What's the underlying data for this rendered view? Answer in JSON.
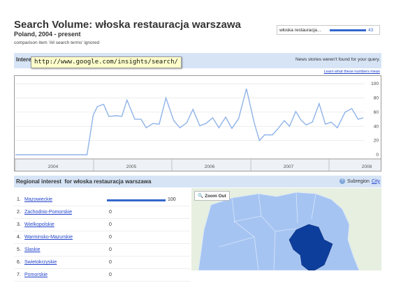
{
  "title": "Search Volume: włoska restauracja warszawa",
  "subtitle": "Poland, 2004 - present",
  "comparison_note": "comparison item 'All search terms' ignored",
  "search_term": {
    "label": "włoska restauracja...",
    "value": "43",
    "fraction": 1.0
  },
  "interest": {
    "label": "Interest",
    "news_note": "News stories weren't found for your query.",
    "learn_link": "Learn what these numbers mean"
  },
  "tooltip_url": "http://www.google.com/insights/search/",
  "chart_data": {
    "type": "line",
    "x_tick_labels": [
      "2004",
      "2005",
      "2006",
      "2007",
      "2008"
    ],
    "y_ticks": [
      0,
      20,
      40,
      60,
      80,
      100
    ],
    "ylim": [
      0,
      110
    ],
    "grid": "horizontal",
    "series": [
      {
        "color": "#8fb3e8",
        "points": [
          [
            2004.0,
            0
          ],
          [
            2004.5,
            0
          ],
          [
            2005.0,
            0
          ],
          [
            2005.2,
            0
          ],
          [
            2005.38,
            0
          ],
          [
            2005.5,
            56
          ],
          [
            2005.58,
            68
          ],
          [
            2005.7,
            71
          ],
          [
            2005.8,
            54
          ],
          [
            2005.95,
            55
          ],
          [
            2006.05,
            54
          ],
          [
            2006.15,
            77
          ],
          [
            2006.3,
            50
          ],
          [
            2006.42,
            50
          ],
          [
            2006.52,
            38
          ],
          [
            2006.65,
            44
          ],
          [
            2006.77,
            43
          ],
          [
            2006.9,
            80
          ],
          [
            2007.05,
            48
          ],
          [
            2007.17,
            38
          ],
          [
            2007.3,
            45
          ],
          [
            2007.42,
            64
          ],
          [
            2007.55,
            41
          ],
          [
            2007.67,
            44
          ],
          [
            2007.8,
            52
          ],
          [
            2007.92,
            38
          ],
          [
            2008.05,
            53
          ],
          [
            2008.17,
            37
          ],
          [
            2008.3,
            51
          ],
          [
            2008.45,
            93
          ],
          [
            2008.6,
            45
          ],
          [
            2008.7,
            20
          ],
          [
            2008.8,
            28
          ],
          [
            2008.95,
            28
          ],
          [
            2009.05,
            36
          ],
          [
            2009.18,
            48
          ],
          [
            2009.28,
            40
          ],
          [
            2009.4,
            61
          ],
          [
            2009.5,
            49
          ],
          [
            2009.6,
            42
          ],
          [
            2009.72,
            46
          ],
          [
            2009.85,
            72
          ],
          [
            2009.97,
            43
          ],
          [
            2010.08,
            46
          ],
          [
            2010.2,
            38
          ],
          [
            2010.35,
            60
          ],
          [
            2010.48,
            65
          ],
          [
            2010.6,
            50
          ],
          [
            2010.7,
            52
          ]
        ]
      }
    ]
  },
  "regional": {
    "label": "Regional interest",
    "label_for": "for włoska restauracja warszawa",
    "subregion_label": "Subregion",
    "subregion_link": "City",
    "items": [
      {
        "num": "1.",
        "name": "Mazowieckie",
        "value": "100",
        "fraction": 1.0
      },
      {
        "num": "2.",
        "name": "Zachodnio-Pomorskie",
        "value": "0",
        "fraction": 0
      },
      {
        "num": "3.",
        "name": "Wielkopolskie",
        "value": "0",
        "fraction": 0
      },
      {
        "num": "4.",
        "name": "Warminsko-Mazurskie",
        "value": "0",
        "fraction": 0
      },
      {
        "num": "5.",
        "name": "Slaskie",
        "value": "0",
        "fraction": 0
      },
      {
        "num": "6.",
        "name": "Swietokrzyskie",
        "value": "0",
        "fraction": 0
      },
      {
        "num": "7.",
        "name": "Pomorskie",
        "value": "0",
        "fraction": 0
      }
    ]
  },
  "map": {
    "zoom_label": "Zoom Out",
    "base_color": "#a6c4f2",
    "highlight_color": "#0d3e9c",
    "background_color": "#e6efe0"
  },
  "colors": {
    "accent": "#3366cc",
    "header_bg": "#d6e4f6",
    "link": "#2244cc"
  }
}
